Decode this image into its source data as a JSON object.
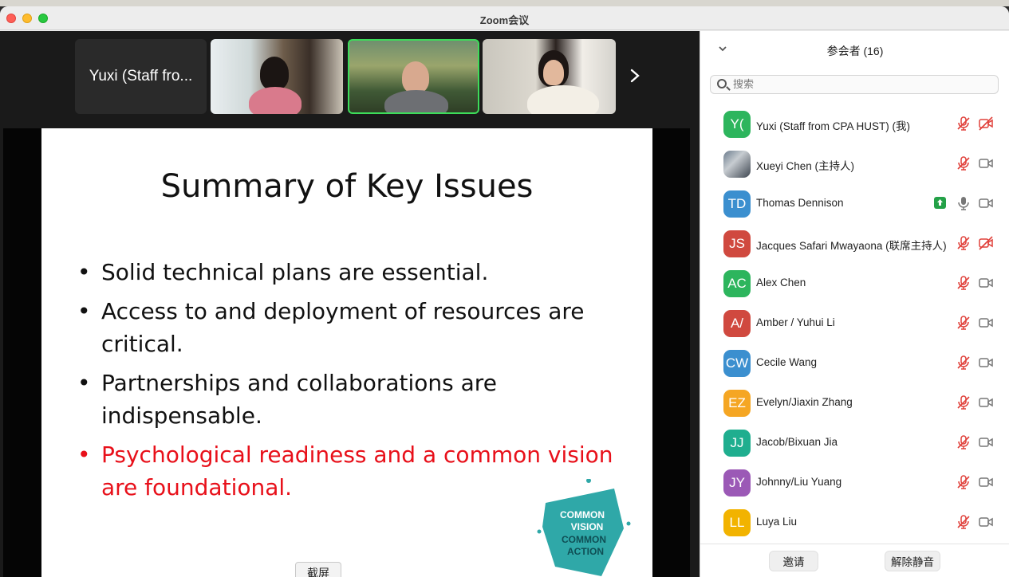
{
  "window": {
    "title": "Zoom会议"
  },
  "video_strip": {
    "name_tile": "Yuxi (Staff fro...",
    "next_icon": "chevron-right-icon"
  },
  "slide": {
    "title": "Summary of Key Issues",
    "bullets": [
      "Solid technical plans are essential.",
      "Access to and deployment of resources are critical.",
      "Partnerships and collaborations are indispensable.",
      "Psychological readiness and a common vision are foundational."
    ],
    "highlight_color": "#e8101a",
    "logo_lines": [
      "COMMON",
      "VISION",
      "COMMON",
      "ACTION"
    ]
  },
  "screenshot_button": "截屏",
  "panel": {
    "title": "参会者 (16)",
    "search_placeholder": "搜索",
    "participants": [
      {
        "initials": "Y(",
        "color": "#2db55d",
        "name": "Yuxi (Staff from CPA HUST) (我)",
        "mic": "muted",
        "cam": "off"
      },
      {
        "initials": "",
        "color": "photo",
        "name": "Xueyi Chen (主持人)",
        "mic": "muted",
        "cam": "on"
      },
      {
        "initials": "TD",
        "color": "#3b8fcf",
        "name": "Thomas Dennison",
        "mic": "on",
        "cam": "on",
        "sharing": true
      },
      {
        "initials": "JS",
        "color": "#d0493f",
        "name": "Jacques Safari Mwayaona (联席主持人)",
        "mic": "muted",
        "cam": "off"
      },
      {
        "initials": "AC",
        "color": "#2db55d",
        "name": "Alex Chen",
        "mic": "muted",
        "cam": "on"
      },
      {
        "initials": "A/",
        "color": "#d0493f",
        "name": "Amber  /  Yuhui Li",
        "mic": "muted",
        "cam": "on"
      },
      {
        "initials": "CW",
        "color": "#3b8fcf",
        "name": "Cecile Wang",
        "mic": "muted",
        "cam": "on"
      },
      {
        "initials": "EZ",
        "color": "#f5a623",
        "name": "Evelyn/Jiaxin Zhang",
        "mic": "muted",
        "cam": "on"
      },
      {
        "initials": "JJ",
        "color": "#1fae8f",
        "name": "Jacob/Bixuan Jia",
        "mic": "muted",
        "cam": "on"
      },
      {
        "initials": "JY",
        "color": "#9b59b6",
        "name": "Johnny/Liu Yuang",
        "mic": "muted",
        "cam": "on"
      },
      {
        "initials": "LL",
        "color": "#f2b300",
        "name": "Luya Liu",
        "mic": "muted",
        "cam": "on"
      }
    ],
    "invite_label": "邀请",
    "unmute_label": "解除静音"
  }
}
